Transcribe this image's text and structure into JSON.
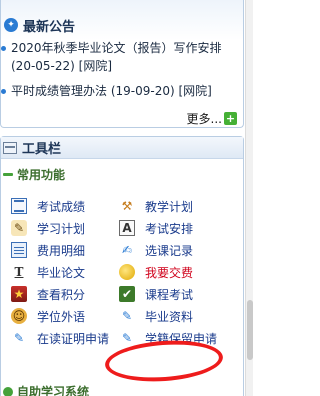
{
  "notices": {
    "title": "最新公告",
    "items": [
      {
        "text": "2020年秋季毕业论文（报告）写作安排(20-05-22)",
        "source": "[网院]"
      },
      {
        "text": "平时成绩管理办法 (19-09-20)",
        "source": "[网院]"
      }
    ],
    "more_label": "更多..."
  },
  "toolbar": {
    "title": "工具栏",
    "section_title": "常用功能",
    "items": [
      {
        "label": "考试成绩",
        "icon": "grades-icon"
      },
      {
        "label": "教学计划",
        "icon": "teaching-plan-icon"
      },
      {
        "label": "学习计划",
        "icon": "study-plan-icon"
      },
      {
        "label": "考试安排",
        "icon": "exam-schedule-icon"
      },
      {
        "label": "费用明细",
        "icon": "fee-details-icon"
      },
      {
        "label": "选课记录",
        "icon": "course-selection-icon"
      },
      {
        "label": "毕业论文",
        "icon": "thesis-icon"
      },
      {
        "label": "我要交费",
        "icon": "pay-fee-icon",
        "highlight": "#d0021b"
      },
      {
        "label": "查看积分",
        "icon": "points-icon"
      },
      {
        "label": "课程考试",
        "icon": "course-exam-icon"
      },
      {
        "label": "学位外语",
        "icon": "degree-language-icon"
      },
      {
        "label": "毕业资料",
        "icon": "graduation-docs-icon"
      },
      {
        "label": "在读证明申请",
        "icon": "enrollment-cert-icon"
      },
      {
        "label": "学籍保留申请",
        "icon": "status-reserve-icon"
      }
    ],
    "next_section_title": "自助学习系统"
  },
  "colors": {
    "accent": "#2a7bd3",
    "link": "#1a3b8c",
    "alert": "#d0021b",
    "annotation_circle": "#ee1c1c"
  }
}
